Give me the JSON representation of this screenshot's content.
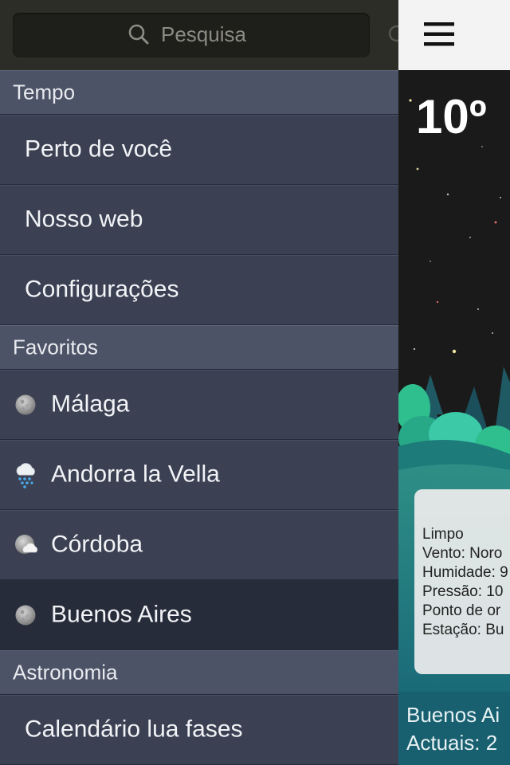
{
  "search": {
    "placeholder": "Pesquisa"
  },
  "menu": {
    "sections": [
      {
        "label": "Tempo",
        "items": [
          {
            "label": "Perto de você"
          },
          {
            "label": "Nosso web"
          },
          {
            "label": "Configurações"
          }
        ]
      },
      {
        "label": "Favoritos",
        "items": [
          {
            "label": "Málaga",
            "icon": "moon-clear-icon"
          },
          {
            "label": "Andorra la Vella",
            "icon": "snow-cloud-icon"
          },
          {
            "label": "Córdoba",
            "icon": "moon-cloud-icon"
          },
          {
            "label": "Buenos Aires",
            "icon": "moon-clear-icon",
            "selected": true
          }
        ]
      },
      {
        "label": "Astronomia",
        "items": [
          {
            "label": "Calendário lua fases"
          }
        ]
      }
    ]
  },
  "weather": {
    "temperature": "10º",
    "details": {
      "condition": "Limpo",
      "wind": "Vento: Noro",
      "humidity": "Humidade: 9",
      "pressure": "Pressão: 10",
      "dew_point": "Ponto de or",
      "station": "Estação: Bu"
    },
    "footer": {
      "city": "Buenos Ai",
      "updated": "Actuais: 2"
    }
  },
  "colors": {
    "menu_bg": "#3b4153",
    "section_bg": "#4c5366",
    "selected_bg": "#272c3a",
    "footer_bg": "#186070"
  }
}
